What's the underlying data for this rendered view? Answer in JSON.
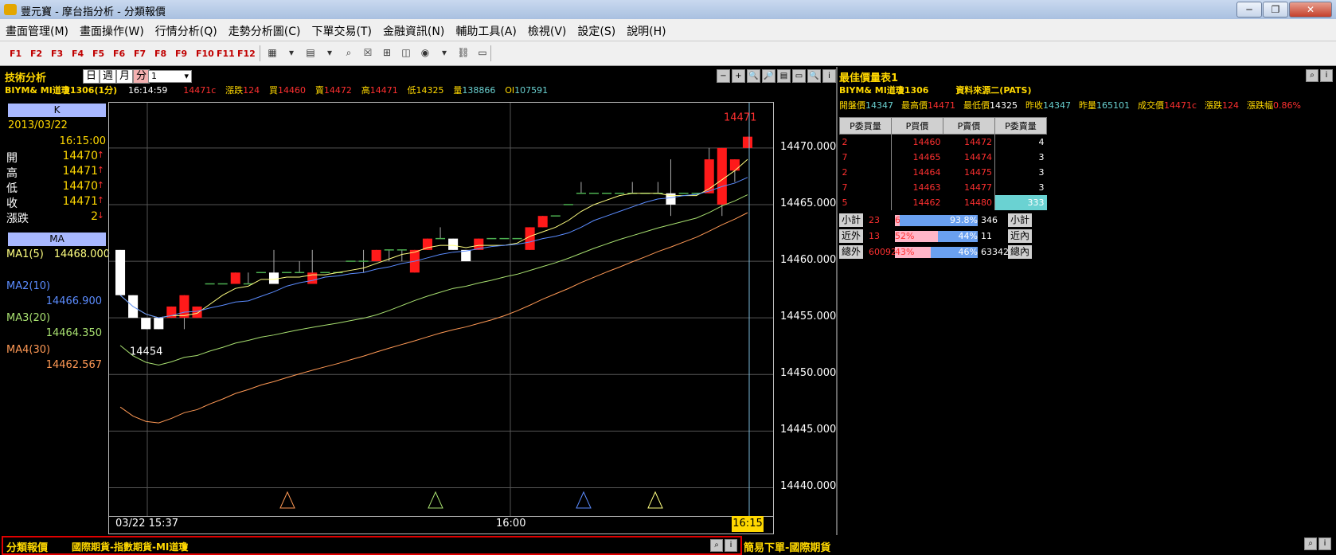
{
  "window": {
    "title": "豐元寶 - 摩台指分析 - 分類報價",
    "minimize": "─",
    "maximize": "❐",
    "close": "✕"
  },
  "menu": [
    "畫面管理(M)",
    "畫面操作(W)",
    "行情分析(Q)",
    "走勢分析圖(C)",
    "下單交易(T)",
    "金融資訊(N)",
    "輔助工具(A)",
    "檢視(V)",
    "設定(S)",
    "說明(H)"
  ],
  "function_keys": [
    "F1",
    "F2",
    "F3",
    "F4",
    "F5",
    "F6",
    "F7",
    "F8",
    "F9",
    "F10",
    "F11",
    "F12"
  ],
  "toolbar_icons": [
    "grid-icon",
    "dropdown-arrow-icon",
    "chart-settings-icon",
    "dropdown-arrow-icon",
    "search-icon",
    "close-box-icon",
    "expand-icon",
    "split-icon",
    "coin-icon",
    "dropdown-arrow-icon",
    "link-icon",
    "window-icon"
  ],
  "tech": {
    "title": "技術分析",
    "period_buttons": [
      "日",
      "週",
      "月",
      "分"
    ],
    "period_value": "1",
    "symbol": "BIYM&  MI道瓊1306(1分)",
    "time": "16:14:59",
    "last": "14471c",
    "change_label": "漲跌",
    "change": "124",
    "bid_label": "買",
    "bid": "14460",
    "ask_label": "賣",
    "ask": "14472",
    "high_label": "高",
    "high": "14471",
    "low_label": "低",
    "low": "14325",
    "vol_label": "量",
    "vol": "138866",
    "oi_label": "OI",
    "oi": "107591",
    "panel_buttons": [
      "−",
      "+",
      "🔍",
      "🔎",
      "▤",
      "▭",
      "🔍",
      "i"
    ]
  },
  "kinfo": {
    "header": "K",
    "date": "2013/03/22",
    "time": "16:15:00",
    "rows": [
      {
        "label": "開",
        "value": "14470"
      },
      {
        "label": "高",
        "value": "14471"
      },
      {
        "label": "低",
        "value": "14470"
      },
      {
        "label": "收",
        "value": "14471"
      },
      {
        "label": "漲跌",
        "value": "2"
      }
    ],
    "ma_header": "MA",
    "ma": [
      {
        "label": "MA1(5)",
        "value": "14468.000",
        "color": "#ffff80"
      },
      {
        "label": "MA2(10)",
        "value": "14466.900",
        "color": "#5b8cff"
      },
      {
        "label": "MA3(20)",
        "value": "14464.350",
        "color": "#a8e070"
      },
      {
        "label": "MA4(30)",
        "value": "14462.567",
        "color": "#ff9955"
      }
    ]
  },
  "chart_data": {
    "type": "candlestick",
    "y_ticks": [
      "14470.000",
      "14465.000",
      "14460.000",
      "14455.000",
      "14450.000",
      "14445.000",
      "14440.000"
    ],
    "ylim": [
      14437.5,
      14474
    ],
    "x_labels": [
      "03/22 15:37",
      "16:00",
      "16:15"
    ],
    "annotations": {
      "low_label": "14454",
      "high_label": "14471"
    },
    "candles": [
      {
        "o": 14461,
        "h": 14461,
        "l": 14457,
        "c": 14457
      },
      {
        "o": 14457,
        "h": 14457,
        "l": 14455,
        "c": 14455
      },
      {
        "o": 14455,
        "h": 14455,
        "l": 14454,
        "c": 14454
      },
      {
        "o": 14455,
        "h": 14455,
        "l": 14454,
        "c": 14454
      },
      {
        "o": 14455,
        "h": 14456,
        "l": 14455,
        "c": 14456
      },
      {
        "o": 14455,
        "h": 14457,
        "l": 14454,
        "c": 14457
      },
      {
        "o": 14455,
        "h": 14456,
        "l": 14455,
        "c": 14456
      },
      {
        "o": 14458,
        "h": 14458,
        "l": 14458,
        "c": 14458
      },
      {
        "o": 14458,
        "h": 14458,
        "l": 14458,
        "c": 14458
      },
      {
        "o": 14458,
        "h": 14459,
        "l": 14458,
        "c": 14459
      },
      {
        "o": 14458,
        "h": 14459,
        "l": 14458,
        "c": 14458
      },
      {
        "o": 14459,
        "h": 14459,
        "l": 14459,
        "c": 14459
      },
      {
        "o": 14459,
        "h": 14461,
        "l": 14458,
        "c": 14458
      },
      {
        "o": 14459,
        "h": 14459,
        "l": 14459,
        "c": 14459
      },
      {
        "o": 14459,
        "h": 14460,
        "l": 14459,
        "c": 14459
      },
      {
        "o": 14458,
        "h": 14461,
        "l": 14458,
        "c": 14459
      },
      {
        "o": 14459,
        "h": 14459,
        "l": 14459,
        "c": 14459
      },
      {
        "o": 14459,
        "h": 14459,
        "l": 14459,
        "c": 14459
      },
      {
        "o": 14460,
        "h": 14460,
        "l": 14460,
        "c": 14460
      },
      {
        "o": 14460,
        "h": 14461,
        "l": 14459,
        "c": 14460
      },
      {
        "o": 14460,
        "h": 14461,
        "l": 14460,
        "c": 14461
      },
      {
        "o": 14461,
        "h": 14461,
        "l": 14460,
        "c": 14461
      },
      {
        "o": 14461,
        "h": 14461,
        "l": 14460,
        "c": 14461
      },
      {
        "o": 14459,
        "h": 14461,
        "l": 14459,
        "c": 14461
      },
      {
        "o": 14461,
        "h": 14462,
        "l": 14461,
        "c": 14462
      },
      {
        "o": 14462,
        "h": 14463,
        "l": 14462,
        "c": 14462
      },
      {
        "o": 14462,
        "h": 14462,
        "l": 14461,
        "c": 14461
      },
      {
        "o": 14461,
        "h": 14461,
        "l": 14460,
        "c": 14460
      },
      {
        "o": 14461,
        "h": 14462,
        "l": 14461,
        "c": 14462
      },
      {
        "o": 14462,
        "h": 14462,
        "l": 14462,
        "c": 14462
      },
      {
        "o": 14462,
        "h": 14462,
        "l": 14462,
        "c": 14462
      },
      {
        "o": 14462,
        "h": 14462,
        "l": 14462,
        "c": 14462
      },
      {
        "o": 14461,
        "h": 14463,
        "l": 14461,
        "c": 14463
      },
      {
        "o": 14463,
        "h": 14464,
        "l": 14463,
        "c": 14464
      },
      {
        "o": 14464,
        "h": 14464,
        "l": 14464,
        "c": 14464
      },
      {
        "o": 14465,
        "h": 14465,
        "l": 14465,
        "c": 14465
      },
      {
        "o": 14466,
        "h": 14467,
        "l": 14466,
        "c": 14466
      },
      {
        "o": 14466,
        "h": 14466,
        "l": 14466,
        "c": 14466
      },
      {
        "o": 14466,
        "h": 14466,
        "l": 14466,
        "c": 14466
      },
      {
        "o": 14466,
        "h": 14466,
        "l": 14466,
        "c": 14466
      },
      {
        "o": 14466,
        "h": 14467,
        "l": 14466,
        "c": 14466
      },
      {
        "o": 14466,
        "h": 14466,
        "l": 14466,
        "c": 14466
      },
      {
        "o": 14466,
        "h": 14467,
        "l": 14466,
        "c": 14466
      },
      {
        "o": 14466,
        "h": 14469,
        "l": 14464,
        "c": 14465
      },
      {
        "o": 14466,
        "h": 14466,
        "l": 14466,
        "c": 14466
      },
      {
        "o": 14466,
        "h": 14466,
        "l": 14466,
        "c": 14466
      },
      {
        "o": 14466,
        "h": 14470,
        "l": 14466,
        "c": 14469
      },
      {
        "o": 14465,
        "h": 14470,
        "l": 14464,
        "c": 14470
      },
      {
        "o": 14468,
        "h": 14469,
        "l": 14467,
        "c": 14469
      },
      {
        "o": 14470,
        "h": 14471,
        "l": 14470,
        "c": 14471
      }
    ]
  },
  "quote": {
    "title": "最佳價量表1",
    "symbol": "BIYM&  MI道瓊1306",
    "source": "資料來源二(PATS)",
    "stats": [
      {
        "label": "開盤價",
        "value": "14347"
      },
      {
        "label": "最高價",
        "value": "14471"
      },
      {
        "label": "最低價",
        "value": "14325"
      },
      {
        "label": "昨收",
        "value": "14347"
      },
      {
        "label": "昨量",
        "value": "165101"
      },
      {
        "label": "成交價",
        "value": "14471c"
      },
      {
        "label": "漲跌",
        "value": "124"
      },
      {
        "label": "漲跌幅",
        "value": "0.86%"
      }
    ],
    "headers": [
      "P委買量",
      "P買價",
      "P賣價",
      "P委賣量"
    ],
    "rows": [
      {
        "bq": "2",
        "bp": "14460",
        "ap": "14472",
        "aq": "4"
      },
      {
        "bq": "7",
        "bp": "14465",
        "ap": "14474",
        "aq": "3"
      },
      {
        "bq": "2",
        "bp": "14464",
        "ap": "14475",
        "aq": "3"
      },
      {
        "bq": "7",
        "bp": "14463",
        "ap": "14477",
        "aq": "3"
      },
      {
        "bq": "5",
        "bp": "14462",
        "ap": "14480",
        "aq": "333"
      }
    ],
    "summary": [
      {
        "left_label": "小計",
        "left_val": "23",
        "left_pct": "6.2%",
        "right_pct": "93.8%",
        "right_val": "346",
        "right_label": "小計",
        "pct_num": 6.2
      },
      {
        "left_label": "近外",
        "left_val": "13",
        "left_pct": "52%",
        "right_pct": "44%",
        "right_val": "11",
        "right_label": "近內",
        "pct_num": 52
      },
      {
        "left_label": "總外",
        "left_val": "60092",
        "left_pct": "43%",
        "right_pct": "46%",
        "right_val": "63342",
        "right_label": "總內",
        "pct_num": 43
      }
    ]
  },
  "bottom": {
    "left_title": "分類報價",
    "left_path": "國際期貨-指數期貨-MI道瓊",
    "right_title": "簡易下單-國際期貨"
  }
}
